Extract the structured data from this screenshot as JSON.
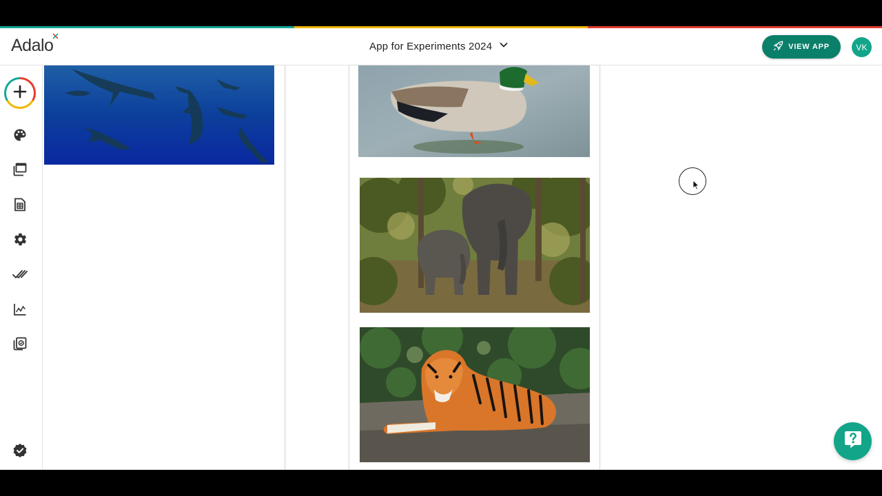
{
  "brand": {
    "logo_text": "Adalo",
    "stripe_colors": [
      "#15a79a",
      "#f2b705",
      "#e63d2f"
    ],
    "accent": "#0a7f6a",
    "accent_light": "#13a58a"
  },
  "header": {
    "app_title": "App for Experiments 2024",
    "view_app_label": "VIEW APP",
    "user_initials": "VK"
  },
  "sidebar": {
    "items": [
      {
        "name": "add-component",
        "icon": "plus-icon"
      },
      {
        "name": "branding",
        "icon": "palette-icon"
      },
      {
        "name": "screens",
        "icon": "screens-icon"
      },
      {
        "name": "database",
        "icon": "database-icon"
      },
      {
        "name": "settings",
        "icon": "gear-icon"
      },
      {
        "name": "publish",
        "icon": "double-check-icon"
      },
      {
        "name": "analytics",
        "icon": "analytics-icon"
      },
      {
        "name": "versions",
        "icon": "copy-check-icon"
      },
      {
        "name": "marketplace",
        "icon": "verified-badge-icon"
      }
    ]
  },
  "canvas": {
    "left_screen_images": [
      "shark-photo"
    ],
    "middle_screen_images": [
      "duck-photo",
      "elephant-photo",
      "tiger-photo"
    ]
  }
}
